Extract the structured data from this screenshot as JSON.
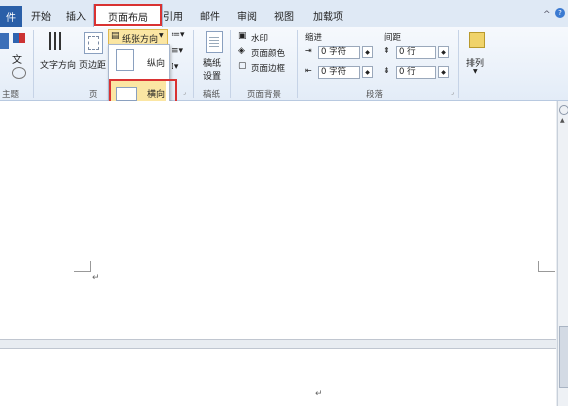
{
  "tabs": {
    "file": "件",
    "home": "开始",
    "insert": "插入",
    "page_layout": "页面布局",
    "references": "引用",
    "mailings": "邮件",
    "review": "审阅",
    "view": "视图",
    "addins": "加载项"
  },
  "ribbon": {
    "themes_label": "主题",
    "text_direction": "文字方向",
    "margins": "页边距",
    "orientation": "纸张方向",
    "portrait": "纵向",
    "landscape": "横向",
    "page_setup_label": "页",
    "draft_paper": [
      "稿纸",
      "设置"
    ],
    "draft_paper_group": "稿纸",
    "watermark": "水印",
    "page_color": "页面颜色",
    "page_border": "页面边框",
    "page_background_group": "页面背景",
    "indent": "缩进",
    "spacing": "间距",
    "indent_left_value": "0 字符",
    "indent_right_value": "0 字符",
    "spacing_before_value": "0 行",
    "spacing_after_value": "0 行",
    "paragraph_group": "段落",
    "arrange": "排列"
  },
  "document": {
    "para_mark": "↵"
  },
  "colors": {
    "highlight_red": "#d93232",
    "file_tab": "#2a5fa8"
  }
}
